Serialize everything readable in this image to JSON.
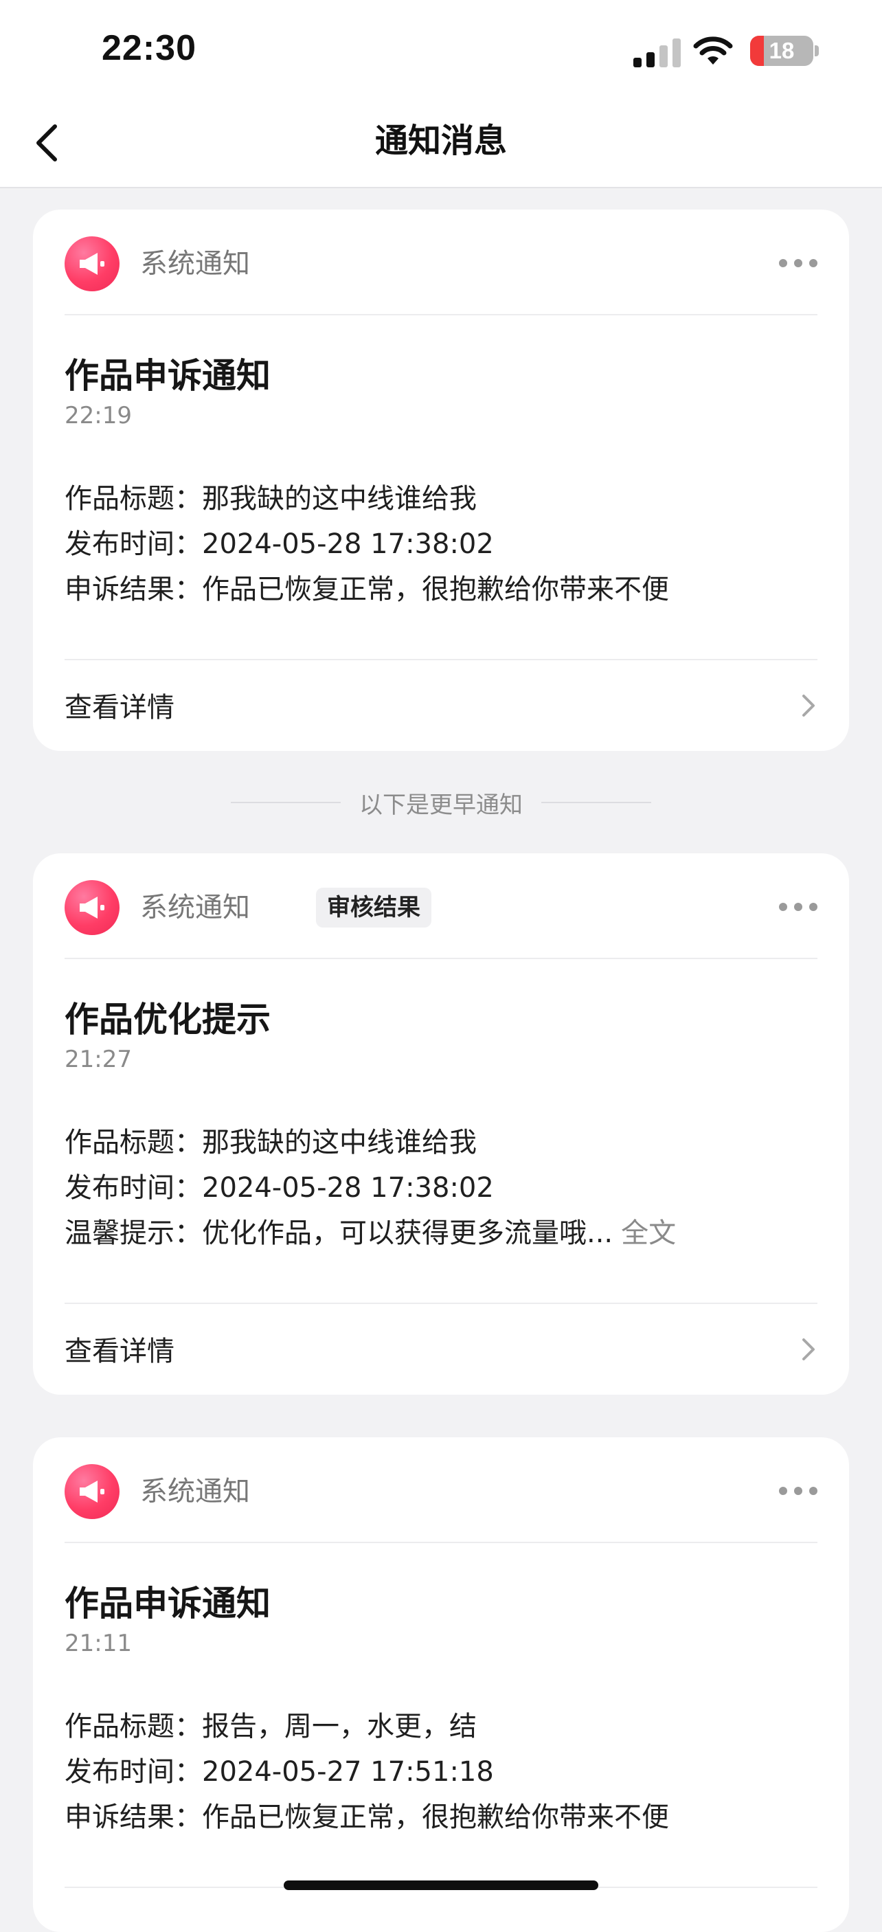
{
  "status_bar": {
    "time": "22:30",
    "battery": "18",
    "battery_color": "#f23a3a"
  },
  "nav": {
    "title": "通知消息",
    "back_icon": "chevron-left-icon"
  },
  "separator": {
    "text": "以下是更早通知"
  },
  "colors": {
    "accent": "#ff3d66",
    "background": "#f2f2f4"
  },
  "cards": [
    {
      "source": "系统通知",
      "tag": "",
      "title": "作品申诉通知",
      "time": "22:19",
      "lines": [
        {
          "label": "作品标题：",
          "value": "那我缺的这中线谁给我"
        },
        {
          "label": "发布时间：",
          "value": "2024-05-28 17:38:02"
        },
        {
          "label": "申诉结果：",
          "value": "作品已恢复正常，很抱歉给你带来不便"
        }
      ],
      "detail": "查看详情"
    },
    {
      "source": "系统通知",
      "tag": "审核结果",
      "title": "作品优化提示",
      "time": "21:27",
      "lines": [
        {
          "label": "作品标题：",
          "value": "那我缺的这中线谁给我"
        },
        {
          "label": "发布时间：",
          "value": "2024-05-28 17:38:02"
        },
        {
          "label": "温馨提示：",
          "value": "优化作品，可以获得更多流量哦...",
          "more": "全文"
        }
      ],
      "detail": "查看详情"
    },
    {
      "source": "系统通知",
      "tag": "",
      "title": "作品申诉通知",
      "time": "21:11",
      "lines": [
        {
          "label": "作品标题：",
          "value": "报告，周一，水更，结"
        },
        {
          "label": "发布时间：",
          "value": "2024-05-27 17:51:18"
        },
        {
          "label": "申诉结果：",
          "value": "作品已恢复正常，很抱歉给你带来不便"
        }
      ]
    }
  ]
}
